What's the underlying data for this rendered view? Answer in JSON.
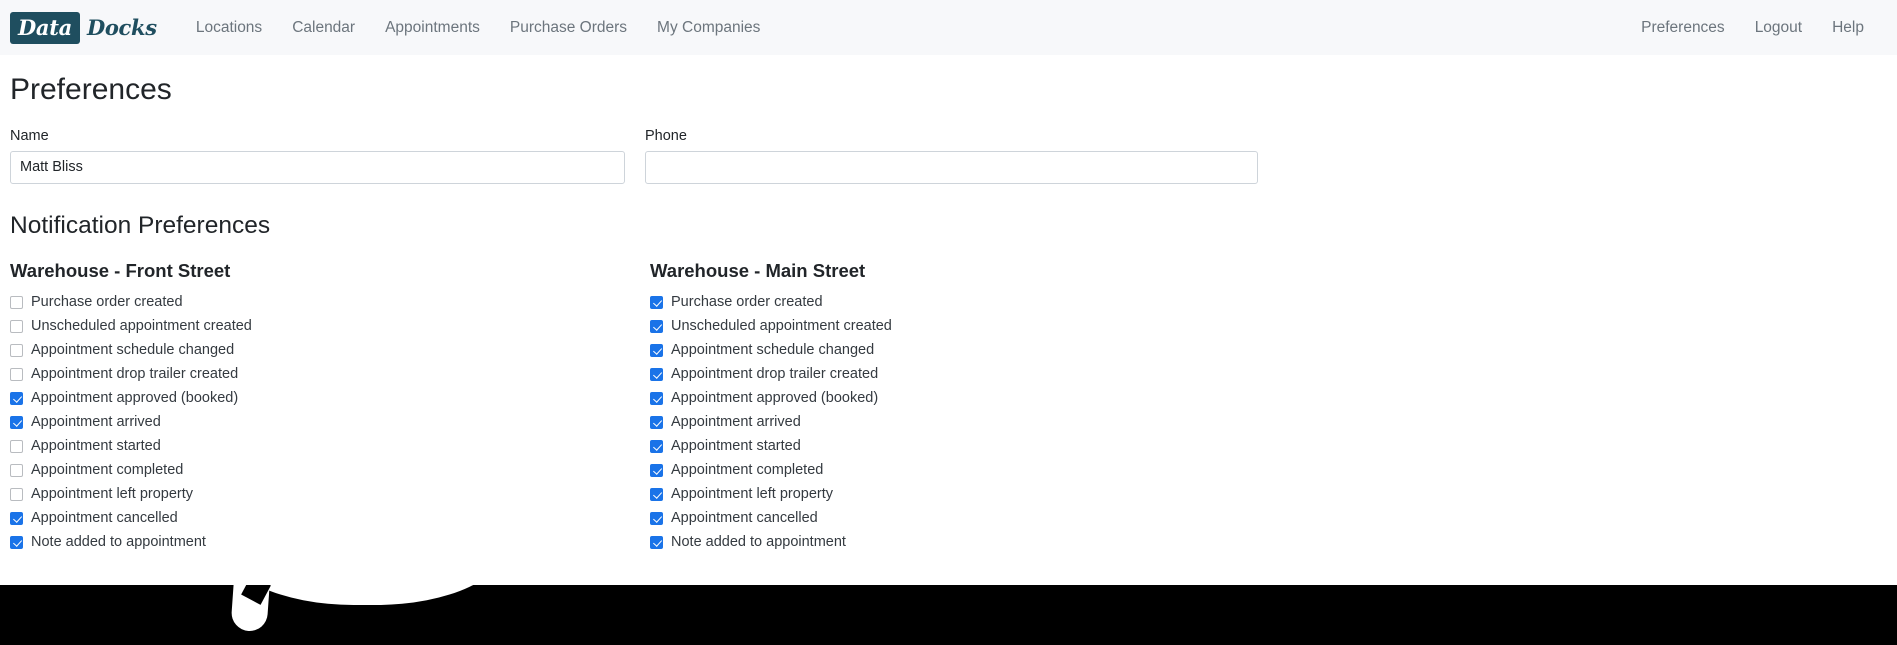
{
  "navbar": {
    "brand": {
      "box_text": "Data",
      "word_text": "Docks",
      "box_color": "#1f4e5f"
    },
    "left_links": [
      {
        "label": "Locations",
        "name": "nav-link-locations"
      },
      {
        "label": "Calendar",
        "name": "nav-link-calendar"
      },
      {
        "label": "Appointments",
        "name": "nav-link-appointments"
      },
      {
        "label": "Purchase Orders",
        "name": "nav-link-purchase-orders"
      },
      {
        "label": "My Companies",
        "name": "nav-link-my-companies"
      }
    ],
    "right_links": [
      {
        "label": "Preferences",
        "name": "nav-link-preferences"
      },
      {
        "label": "Logout",
        "name": "nav-link-logout"
      },
      {
        "label": "Help",
        "name": "nav-link-help"
      }
    ],
    "background": "#f7f8fa",
    "link_color": "#6c757d"
  },
  "page": {
    "title": "Preferences",
    "section_title": "Notification Preferences"
  },
  "form": {
    "name": {
      "label": "Name",
      "value": "Matt Bliss",
      "placeholder": ""
    },
    "phone": {
      "label": "Phone",
      "value": "",
      "placeholder": ""
    }
  },
  "notifications": {
    "accent_checked_color": "#1a73e8",
    "unchecked_border_color": "#b9bcc0",
    "columns": [
      {
        "title": "Warehouse - Front Street",
        "items": [
          {
            "label": "Purchase order created",
            "checked": false
          },
          {
            "label": "Unscheduled appointment created",
            "checked": false
          },
          {
            "label": "Appointment schedule changed",
            "checked": false
          },
          {
            "label": "Appointment drop trailer created",
            "checked": false
          },
          {
            "label": "Appointment approved (booked)",
            "checked": true
          },
          {
            "label": "Appointment arrived",
            "checked": true
          },
          {
            "label": "Appointment started",
            "checked": false
          },
          {
            "label": "Appointment completed",
            "checked": false
          },
          {
            "label": "Appointment left property",
            "checked": false
          },
          {
            "label": "Appointment cancelled",
            "checked": true
          },
          {
            "label": "Note added to appointment",
            "checked": true
          }
        ]
      },
      {
        "title": "Warehouse - Main Street",
        "items": [
          {
            "label": "Purchase order created",
            "checked": true
          },
          {
            "label": "Unscheduled appointment created",
            "checked": true
          },
          {
            "label": "Appointment schedule changed",
            "checked": true
          },
          {
            "label": "Appointment drop trailer created",
            "checked": true
          },
          {
            "label": "Appointment approved (booked)",
            "checked": true
          },
          {
            "label": "Appointment arrived",
            "checked": true
          },
          {
            "label": "Appointment started",
            "checked": true
          },
          {
            "label": "Appointment completed",
            "checked": true
          },
          {
            "label": "Appointment left property",
            "checked": true
          },
          {
            "label": "Appointment cancelled",
            "checked": true
          },
          {
            "label": "Note added to appointment",
            "checked": true
          }
        ]
      }
    ]
  },
  "bottom_bar": {
    "background": "#000000"
  }
}
